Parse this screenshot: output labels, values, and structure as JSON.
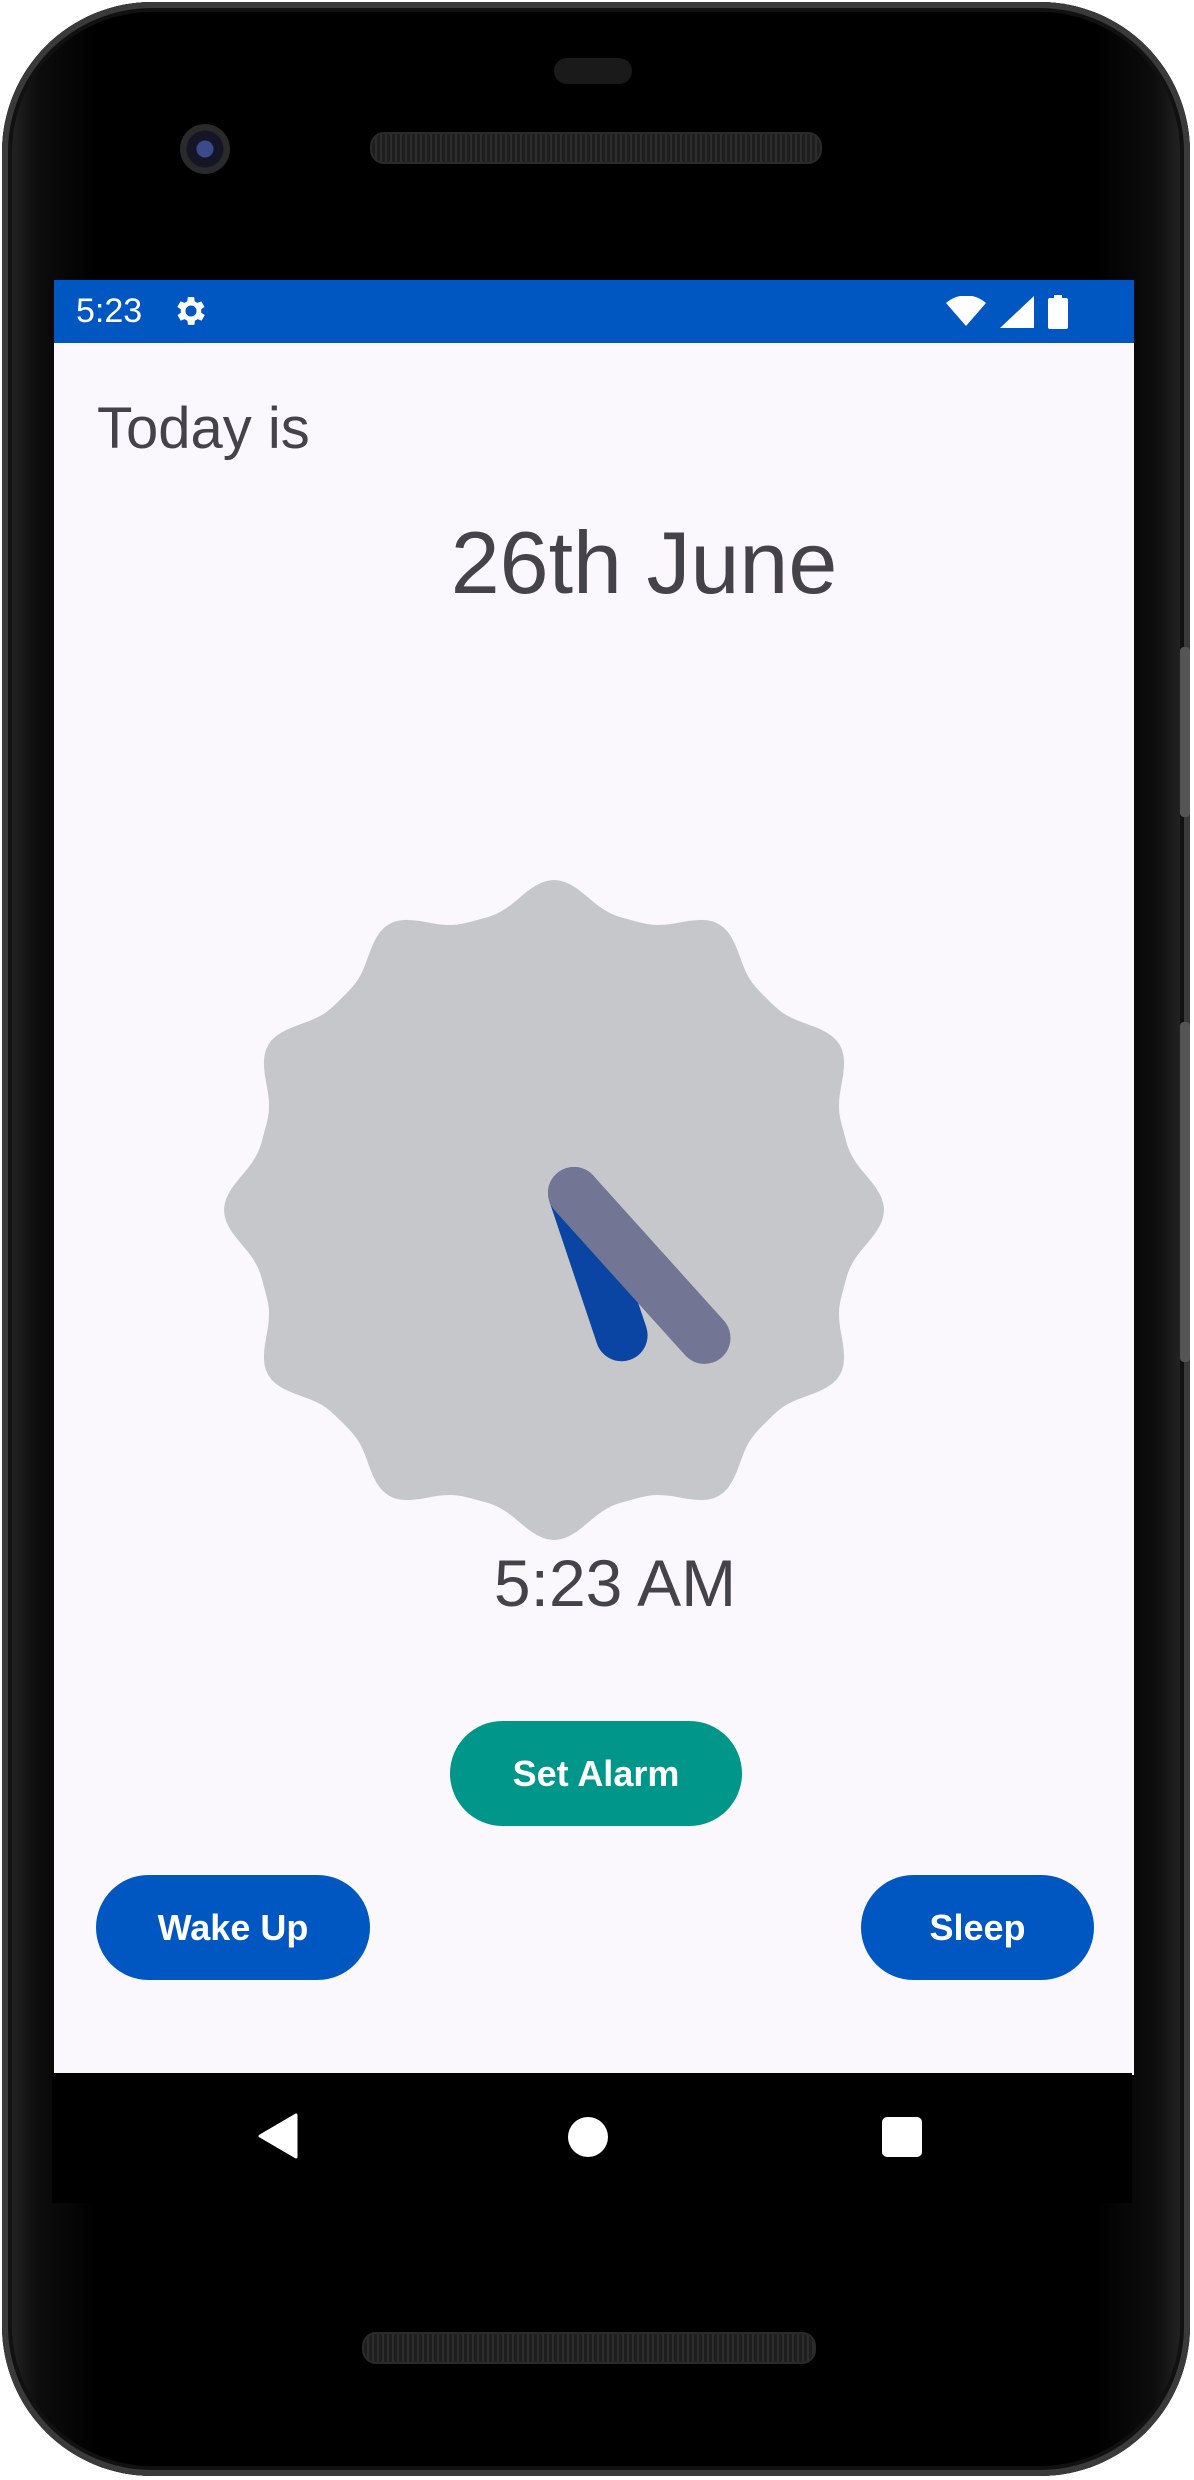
{
  "status_bar": {
    "time": "5:23",
    "background_color": "#0057c2",
    "icons": [
      "gear-icon",
      "wifi-icon",
      "signal-icon",
      "battery-icon"
    ]
  },
  "main": {
    "today_label": "Today is",
    "date": "26th June",
    "time": "5:23 AM",
    "clock": {
      "hour": 5,
      "minute": 23,
      "face_color": "#c6c7ca",
      "hour_hand_color": "#0a45a3",
      "minute_hand_color": "#737595"
    }
  },
  "buttons": {
    "set_alarm": "Set Alarm",
    "wake_up": "Wake Up",
    "sleep": "Sleep"
  },
  "colors": {
    "accent": "#0057c2",
    "teal": "#00968a",
    "text": "#45434a",
    "background": "#fbf8fd"
  },
  "nav_bar": {
    "icons": [
      "back-icon",
      "home-icon",
      "recent-apps-icon"
    ]
  }
}
